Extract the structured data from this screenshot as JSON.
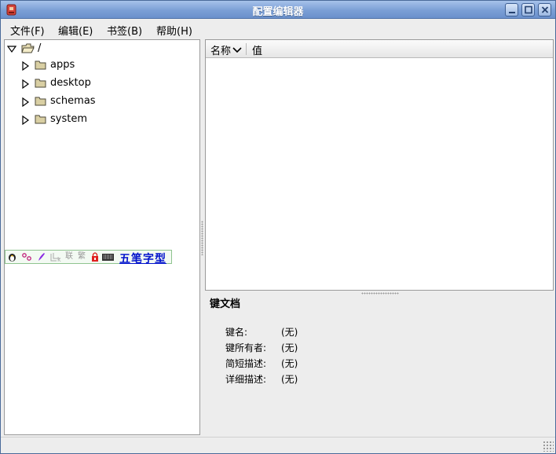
{
  "window": {
    "title": "配置编辑器",
    "app_icon": "gconf-editor-icon",
    "buttons": {
      "minimize": "minimize-icon",
      "maximize": "maximize-icon",
      "close": "close-icon"
    }
  },
  "menubar": {
    "items": [
      {
        "label": "文件(F)"
      },
      {
        "label": "编辑(E)"
      },
      {
        "label": "书签(B)"
      },
      {
        "label": "帮助(H)"
      }
    ]
  },
  "tree": {
    "root": {
      "label": "/",
      "expanded": true,
      "icon": "folder-open-icon"
    },
    "children": [
      {
        "label": "apps",
        "expanded": false,
        "icon": "folder-icon"
      },
      {
        "label": "desktop",
        "expanded": false,
        "icon": "folder-icon"
      },
      {
        "label": "schemas",
        "expanded": false,
        "icon": "folder-icon"
      },
      {
        "label": "system",
        "expanded": false,
        "icon": "folder-icon"
      }
    ]
  },
  "ime_toolbar": {
    "icons": [
      "penguin-icon",
      "punctuation-icon",
      "brush-icon",
      "soft-keyboard-icon",
      "lian-icon",
      "fan-icon",
      "lock-icon",
      "keyboard-icon"
    ],
    "lian": "联",
    "fan": "繁",
    "input_method": "五笔字型"
  },
  "list": {
    "columns": {
      "name": "名称",
      "value": "值"
    },
    "sort_icon": "chevron-down-icon",
    "rows": []
  },
  "key_doc": {
    "title": "键文档",
    "fields": [
      {
        "label": "键名:",
        "value": "(无)"
      },
      {
        "label": "键所有者:",
        "value": "(无)"
      },
      {
        "label": "简短描述:",
        "value": "(无)"
      },
      {
        "label": "详细描述:",
        "value": "(无)"
      }
    ]
  },
  "colors": {
    "titlebar_top": "#a7c2ea",
    "titlebar_bottom": "#6a90cb",
    "ime_text": "#0011cc",
    "folder": "#d9cfa3"
  }
}
